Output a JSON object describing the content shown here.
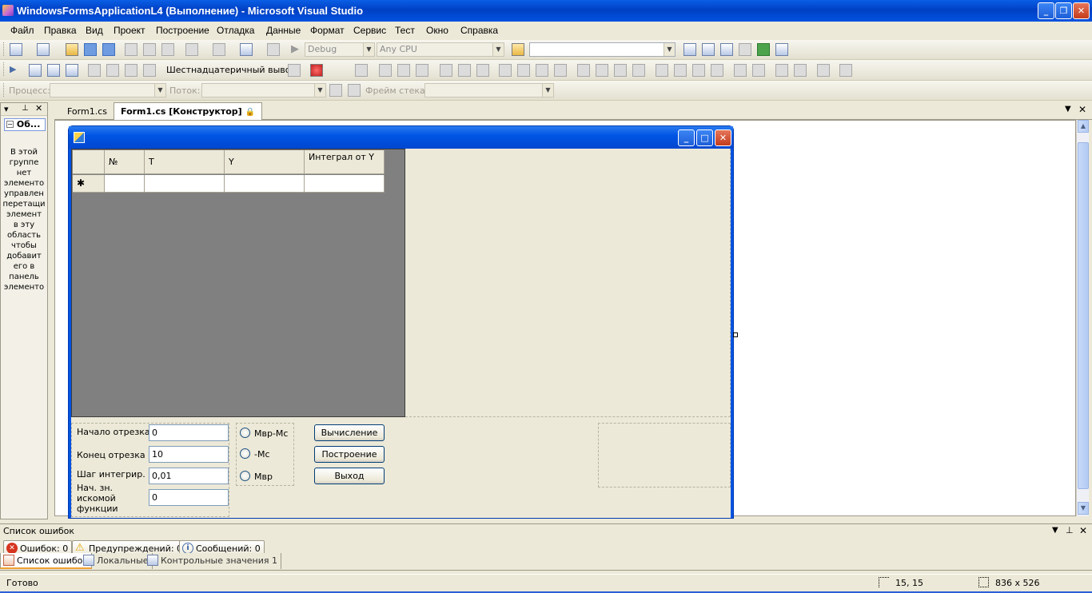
{
  "window": {
    "title": "WindowsFormsApplicationL4 (Выполнение) - Microsoft Visual Studio"
  },
  "menu": [
    "Файл",
    "Правка",
    "Вид",
    "Проект",
    "Построение",
    "Отладка",
    "Данные",
    "Формат",
    "Сервис",
    "Тест",
    "Окно",
    "Справка"
  ],
  "toolbar1": {
    "config": "Debug",
    "platform": "Any CPU",
    "find": ""
  },
  "toolbar2": {
    "hex_label": "Шестнадцатеричный вывод"
  },
  "toolbar3": {
    "process_label": "Процесс:",
    "thread_label": "Поток:",
    "stack_label": "Фрейм стека:"
  },
  "left_panel": {
    "title": "Об...",
    "text": [
      "В этой",
      "группе",
      "нет",
      "элементо",
      "управлен",
      "перетащи",
      "элемент",
      "в эту",
      "область",
      "чтобы",
      "добавит",
      "его в",
      "панель",
      "элементо"
    ]
  },
  "tabs": [
    {
      "label": "Form1.cs",
      "active": false
    },
    {
      "label": "Form1.cs [Конструктор]",
      "active": true
    }
  ],
  "form": {
    "grid_columns": [
      "№",
      "T",
      "Y",
      "Интеграл от Y"
    ],
    "new_row_marker": "✱",
    "labels": {
      "start": "Начало отрезка",
      "end": "Конец отрезка",
      "step": "Шаг интегрир.",
      "initial": "Нач. зн. искомой функции"
    },
    "values": {
      "start": "0",
      "end": "10",
      "step": "0,01",
      "initial": "0"
    },
    "radios": [
      "Мвр-Мс",
      "-Мс",
      "Мвр"
    ],
    "buttons": {
      "compute": "Вычисление",
      "build": "Построение",
      "exit": "Выход"
    }
  },
  "error_list": {
    "title": "Список ошибок",
    "errors": "Ошибок: 0",
    "warnings": "Предупреждений: 0",
    "messages": "Сообщений: 0"
  },
  "bottom_tabs": [
    "Список ошибок",
    "Локальные",
    "Контрольные значения 1"
  ],
  "status": {
    "text": "Готово",
    "position": "15, 15",
    "size": "836 x 526"
  }
}
